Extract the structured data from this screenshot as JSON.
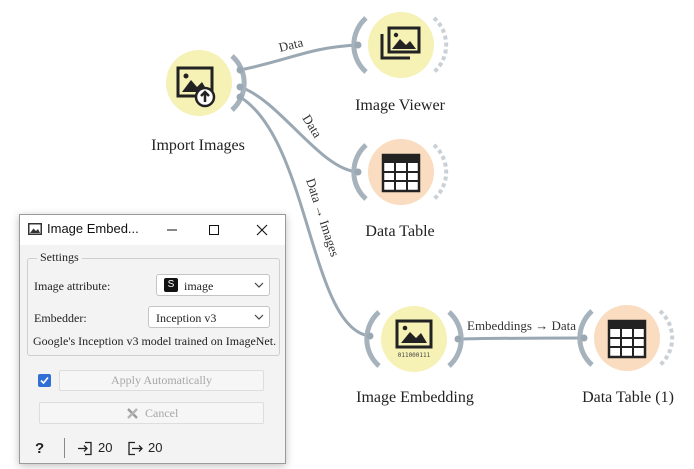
{
  "workflow": {
    "widgets": {
      "import_images": {
        "label": "Import Images",
        "icon": "import-images-icon"
      },
      "image_viewer": {
        "label": "Image Viewer",
        "icon": "image-viewer-icon"
      },
      "data_table": {
        "label": "Data Table",
        "icon": "table-icon"
      },
      "image_embedding": {
        "label": "Image Embedding",
        "icon": "image-embedding-icon",
        "icon_caption": "011000111"
      },
      "data_table_1": {
        "label": "Data Table (1)",
        "icon": "table-icon"
      }
    },
    "links": {
      "to_viewer": "Data",
      "to_table": "Data",
      "to_embedding": "Data → Images",
      "embedding_to_table": "Embeddings → Data"
    },
    "colors": {
      "image_widget": "#f6f1b5",
      "table_widget": "#fadcc0",
      "link": "#9aa8b3",
      "channel": "#a6b3bd"
    }
  },
  "dialog": {
    "title": "Image Embed...",
    "settings": {
      "legend": "Settings",
      "image_attribute_label": "Image attribute:",
      "image_attribute_value": "image",
      "image_attribute_type_badge": "S",
      "embedder_label": "Embedder:",
      "embedder_value": "Inception v3",
      "description": "Google's Inception v3 model trained on ImageNet."
    },
    "apply_automatically": {
      "label": "Apply Automatically",
      "checked": true
    },
    "cancel_label": "Cancel",
    "status": {
      "input_count": "20",
      "output_count": "20"
    }
  }
}
